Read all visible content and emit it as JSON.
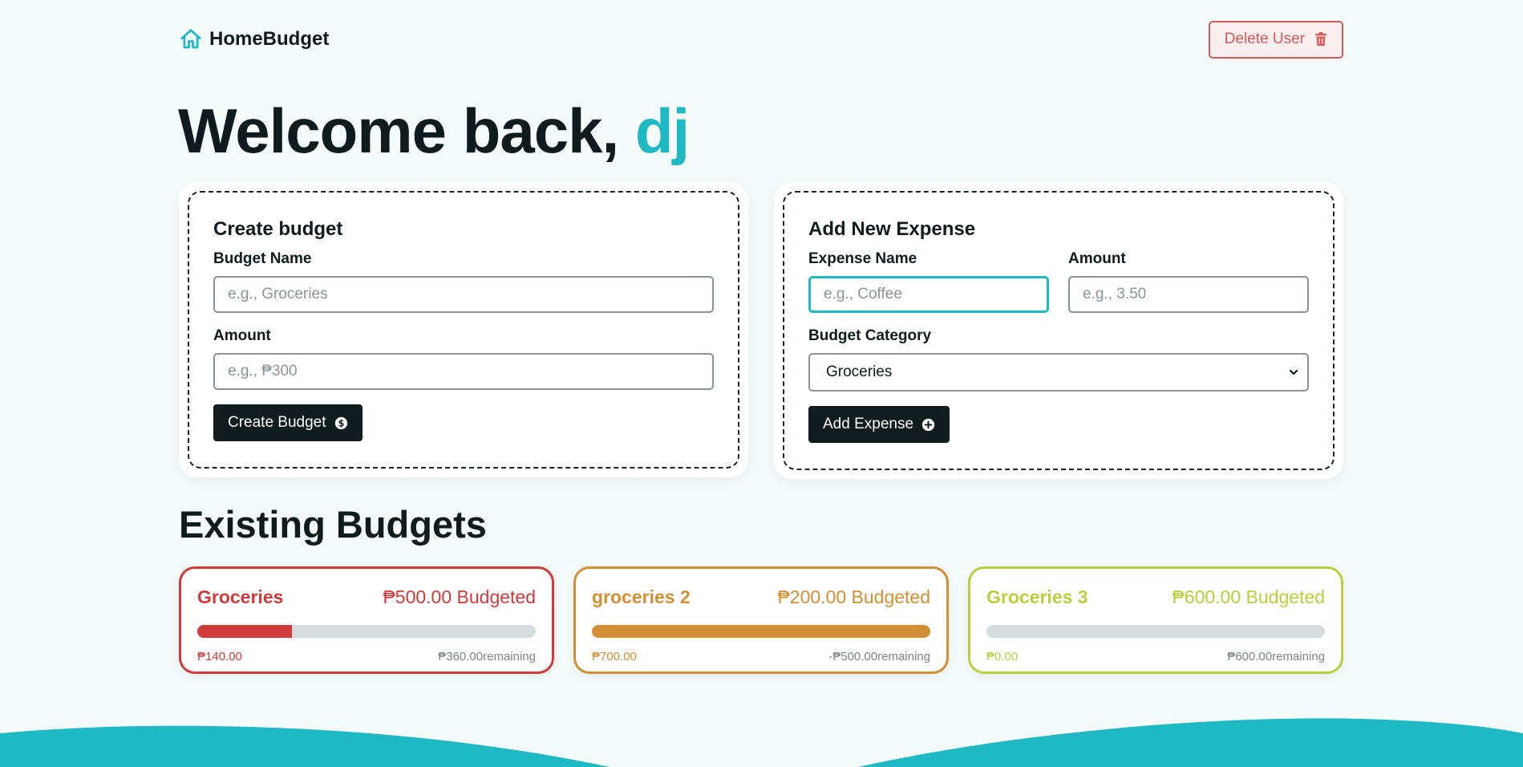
{
  "header": {
    "brand_name": "HomeBudget",
    "delete_label": "Delete User"
  },
  "welcome": {
    "prefix": "Welcome back, ",
    "username": "dj"
  },
  "create_budget": {
    "title": "Create budget",
    "name_label": "Budget Name",
    "name_placeholder": "e.g., Groceries",
    "amount_label": "Amount",
    "amount_placeholder": "e.g., ₱300",
    "button_label": "Create Budget"
  },
  "add_expense": {
    "title": "Add New Expense",
    "name_label": "Expense Name",
    "name_placeholder": "e.g., Coffee",
    "amount_label": "Amount",
    "amount_placeholder": "e.g., 3.50",
    "category_label": "Budget Category",
    "category_selected": "Groceries",
    "button_label": "Add Expense"
  },
  "existing": {
    "title": "Existing Budgets",
    "budgets": [
      {
        "name": "Groceries",
        "budgeted": "₱500.00 Budgeted",
        "spent": "₱140.00",
        "remaining": "₱360.00remaining",
        "progress": 0.28,
        "color": "#d03a3a"
      },
      {
        "name": "groceries 2",
        "budgeted": "₱200.00 Budgeted",
        "spent": "₱700.00",
        "remaining": "-₱500.00remaining",
        "progress": 1.0,
        "color": "#d28f33"
      },
      {
        "name": "Groceries 3",
        "budgeted": "₱600.00 Budgeted",
        "spent": "₱0.00",
        "remaining": "₱600.00remaining",
        "progress": 0.0,
        "color": "#b9cf3b"
      }
    ]
  },
  "colors": {
    "accent": "#1fb9c4",
    "danger": "#d55a5a",
    "dark": "#101c1e"
  }
}
